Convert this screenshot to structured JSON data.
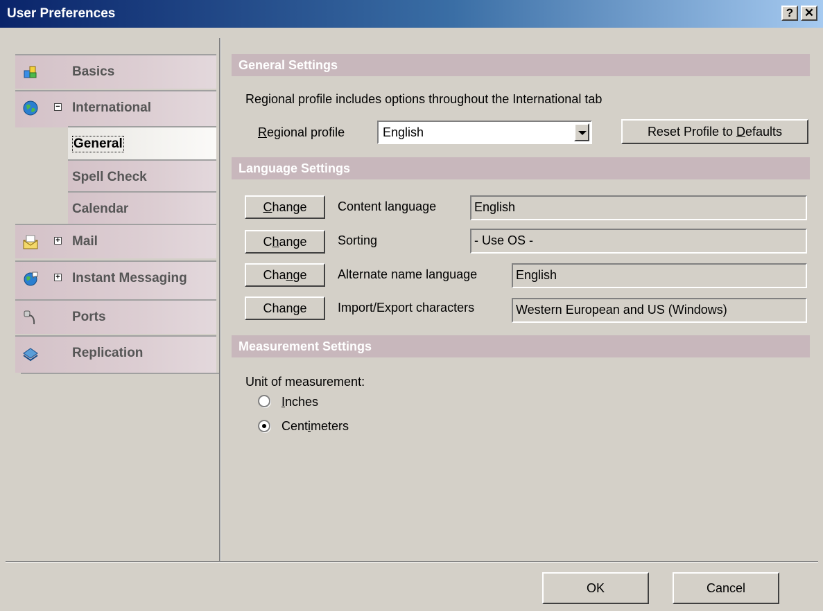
{
  "window": {
    "title": "User Preferences",
    "help_button": "?",
    "close_button": "✕"
  },
  "nav": {
    "items": [
      {
        "label": "Basics",
        "icon": "basics-icon"
      },
      {
        "label": "International",
        "icon": "globe-icon",
        "expander": "−"
      },
      {
        "label": "General",
        "selected": true
      },
      {
        "label": "Spell Check"
      },
      {
        "label": "Calendar"
      },
      {
        "label": "Mail",
        "icon": "mail-icon",
        "expander": "+"
      },
      {
        "label": "Instant Messaging",
        "icon": "instant-messaging-icon",
        "expander": "+"
      },
      {
        "label": "Ports",
        "icon": "ports-icon"
      },
      {
        "label": "Replication",
        "icon": "replication-icon"
      }
    ]
  },
  "general_settings": {
    "header": "General Settings",
    "description": "Regional profile includes options throughout the International tab",
    "regional_profile_label": "Regional profile",
    "regional_profile_value": "English",
    "reset_button": "Reset Profile to Defaults"
  },
  "language_settings": {
    "header": "Language Settings",
    "rows": [
      {
        "button": "Change",
        "label": "Content language",
        "value": "English"
      },
      {
        "button": "Change",
        "label": "Sorting",
        "value": "- Use OS -"
      },
      {
        "button": "Change",
        "label": "Alternate name language",
        "value": "English"
      },
      {
        "button": "Change",
        "label": "Import/Export characters",
        "value": "Western European and US (Windows)"
      }
    ]
  },
  "measurement_settings": {
    "header": "Measurement Settings",
    "unit_label": "Unit of measurement:",
    "options": [
      {
        "label": "Inches",
        "checked": false
      },
      {
        "label": "Centimeters",
        "checked": true
      }
    ]
  },
  "footer": {
    "ok": "OK",
    "cancel": "Cancel"
  }
}
